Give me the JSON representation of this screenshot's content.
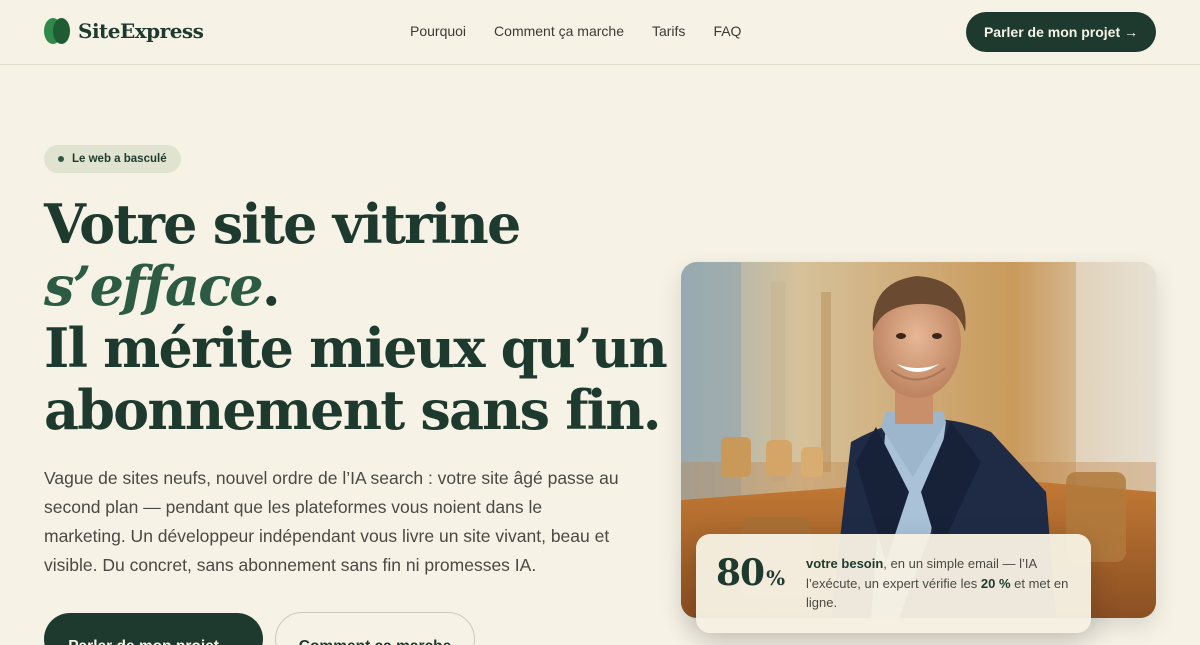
{
  "brand": {
    "name": "SiteExpress",
    "color": "#1e3a2f",
    "accent": "#2f8a4a"
  },
  "nav": {
    "items": [
      {
        "label": "Pourquoi"
      },
      {
        "label": "Comment ça marche"
      },
      {
        "label": "Tarifs"
      },
      {
        "label": "FAQ"
      }
    ],
    "cta_label": "Parler de mon projet →"
  },
  "hero": {
    "badge": "Le web a basculé",
    "headline": {
      "line1": "Votre site vitrine",
      "line2_italic": "s’efface",
      "line2_punct": ".",
      "line3": "Il mérite mieux qu’un",
      "line4": "abonnement sans fin."
    },
    "lead": "Vague de sites neufs, nouvel ordre de l’IA search : votre site âgé passe au second plan — pendant que les plateformes vous noient dans le marketing. Un développeur indépendant vous livre un site vivant, beau et visible. Du concret, sans abonnement sans fin ni promesses IA.",
    "primary_button": "Parler de mon projet →",
    "secondary_button": "Comment ça marche"
  },
  "stat_card": {
    "number": "80",
    "unit": "%",
    "text_bold_1": "votre besoin",
    "text_1": ", en un simple email — l’IA l’exécute, un expert vérifie les ",
    "text_bold_2": "20 %",
    "text_2": " et met en ligne."
  }
}
